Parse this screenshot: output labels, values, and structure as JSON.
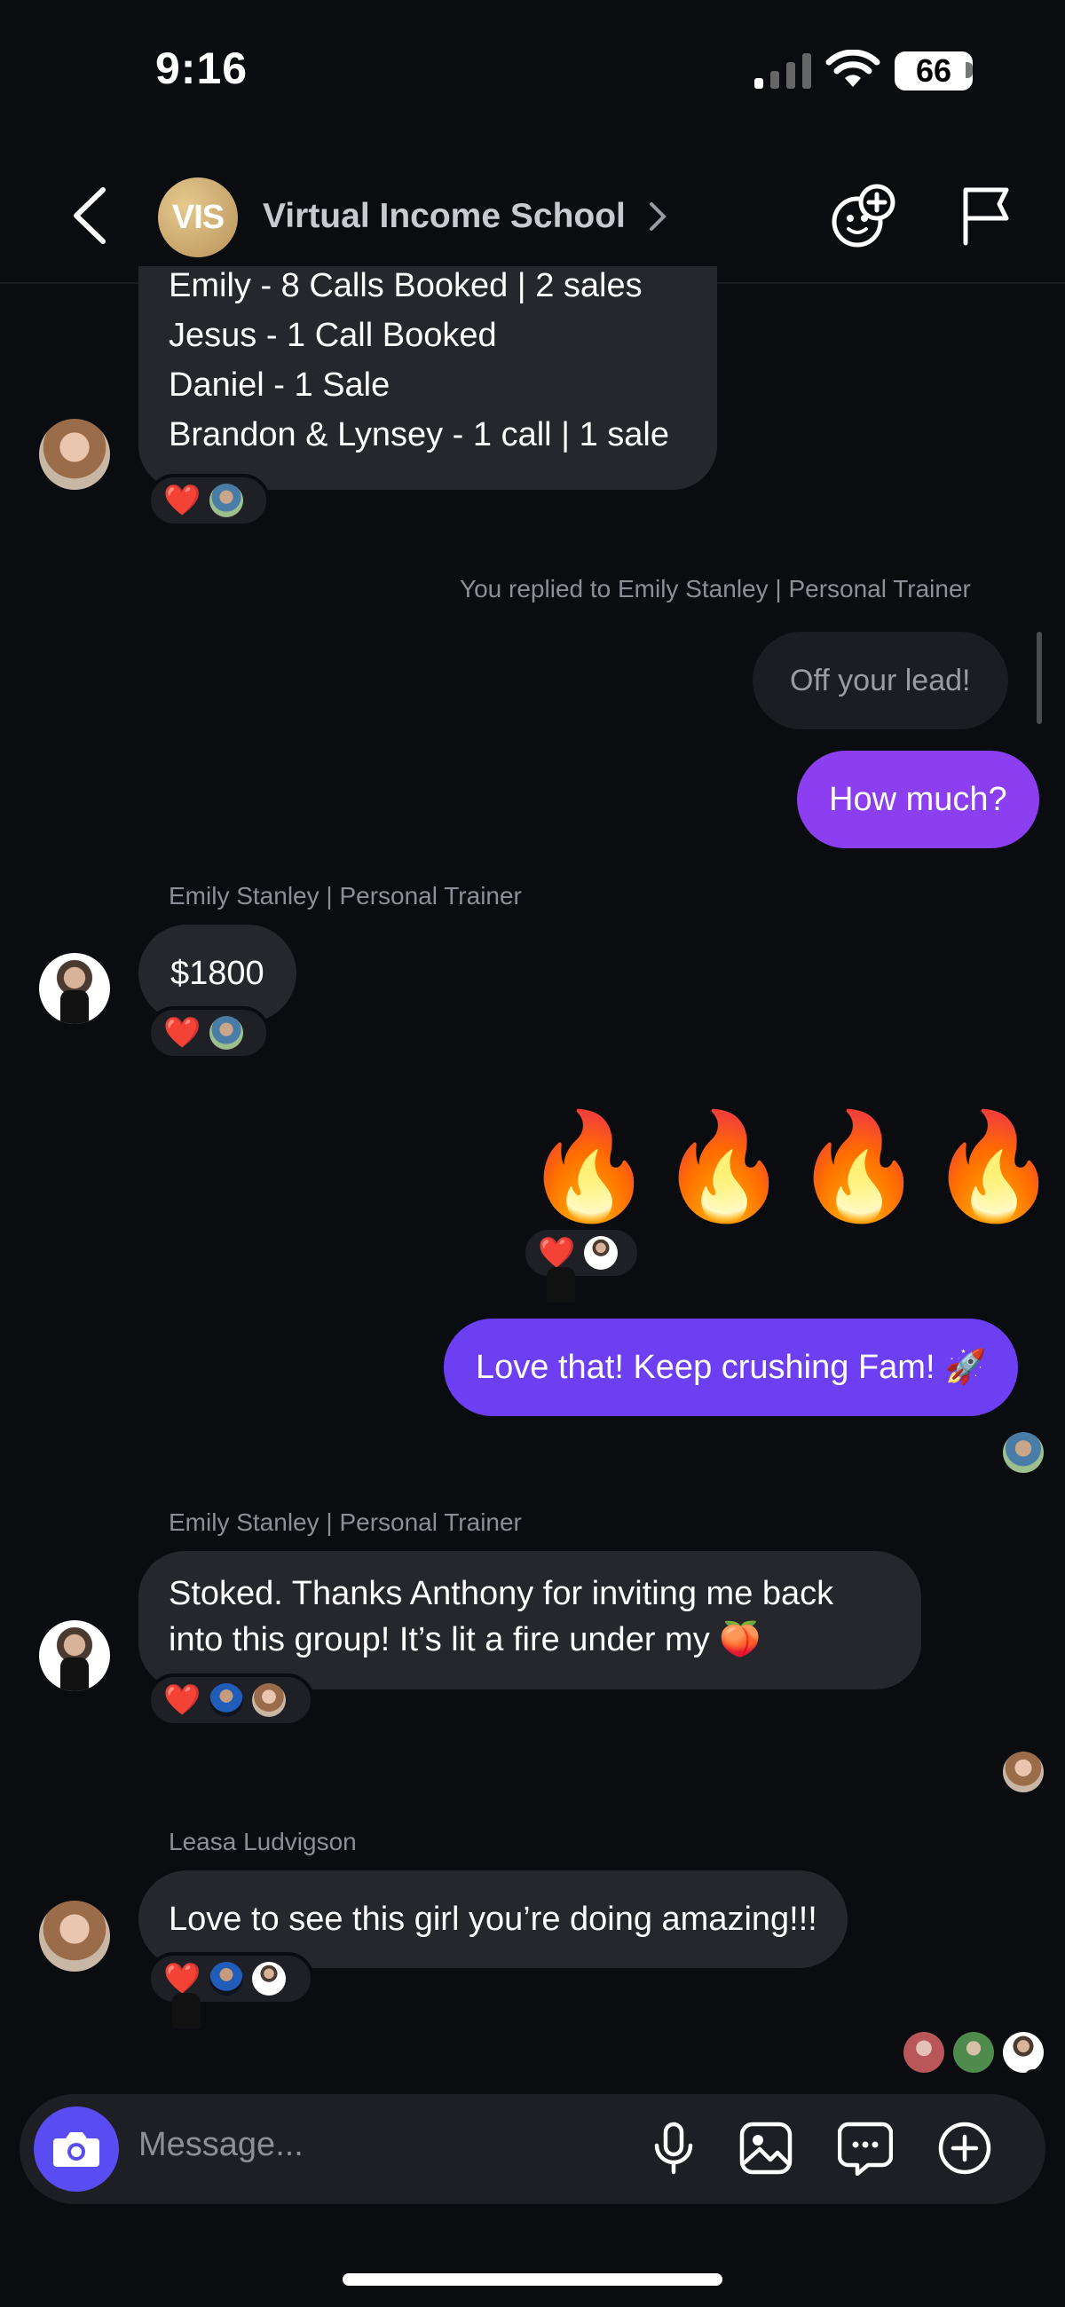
{
  "status_bar": {
    "time": "9:16",
    "battery": "66"
  },
  "header": {
    "group_name": "Virtual Income School",
    "logo_text": "VIS"
  },
  "messages": {
    "m1": {
      "lines": [
        "Emily - 8 Calls Booked | 2 sales",
        "Jesus - 1 Call Booked",
        "Daniel - 1 Sale",
        "Brandon & Lynsey - 1 call | 1 sale"
      ],
      "reaction": "❤️"
    },
    "reply_note": "You replied to Emily Stanley | Personal Trainer",
    "reply_quote": "Off your lead!",
    "m2": {
      "text": "How much?"
    },
    "m3": {
      "sender": "Emily Stanley | Personal Trainer",
      "text": "$1800",
      "reaction": "❤️"
    },
    "m4": {
      "emoji": [
        "🔥",
        "🔥",
        "🔥",
        "🔥"
      ],
      "reaction": "❤️"
    },
    "m5": {
      "text": "Love that! Keep crushing Fam! 🚀"
    },
    "m6": {
      "sender": "Emily Stanley | Personal Trainer",
      "lines": [
        "Stoked. Thanks Anthony for inviting me back",
        "into this group! It’s lit a fire under my 🍑"
      ],
      "reaction": "❤️"
    },
    "m7": {
      "sender": "Leasa Ludvigson",
      "text": "Love to see this girl you’re doing amazing!!!",
      "reaction": "❤️"
    }
  },
  "composer": {
    "placeholder": "Message..."
  },
  "icons": {
    "back": "chevron-left-icon",
    "add_emoji": "emoji-plus-icon",
    "flag": "flag-icon",
    "camera": "camera-icon",
    "mic": "microphone-icon",
    "gallery": "image-icon",
    "sticker": "chat-bubble-icon",
    "plus": "plus-circle-icon"
  },
  "colors": {
    "outgoing": "#8b3ff0",
    "outgoing_alt": "#6d3ff2",
    "incoming": "#26272d",
    "camera_button": "#5a4cf3",
    "background": "#0b0c10"
  }
}
